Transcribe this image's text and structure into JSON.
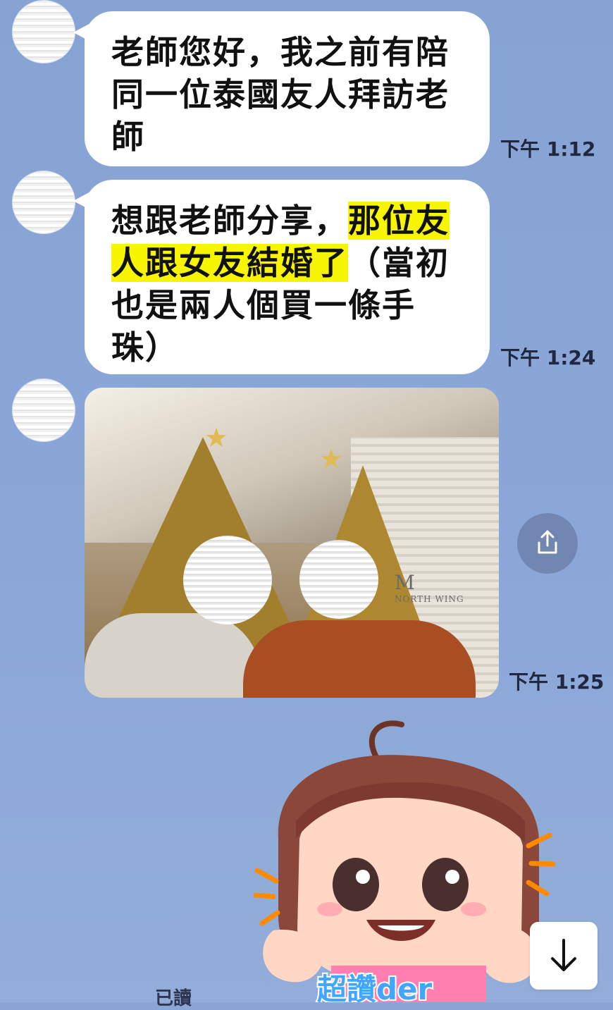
{
  "messages": [
    {
      "text": "老師您好，我之前有陪同一位泰國友人拜訪老師",
      "time": "下午 1:12"
    },
    {
      "text_parts": [
        "想跟老師分享，",
        "那位友人跟女友",
        "結婚",
        "了",
        "（當初也是兩人個買一條手珠）"
      ],
      "time": "下午 1:24"
    },
    {
      "image_description": "Photo message with two people in front of golden Christmas trees",
      "image_logo_text": "M",
      "image_logo_subtext": "NORTH WING",
      "time": "下午 1:25"
    }
  ],
  "sticker": {
    "visible_text": "超讚der"
  },
  "status": {
    "read_label": "已讀"
  },
  "icons": {
    "share": "share-icon",
    "scroll_down": "arrow-down-icon"
  },
  "colors": {
    "background": "#8aa5d6",
    "bubble": "#ffffff",
    "highlight": "#f7f500",
    "share_button": "#7187b2"
  }
}
